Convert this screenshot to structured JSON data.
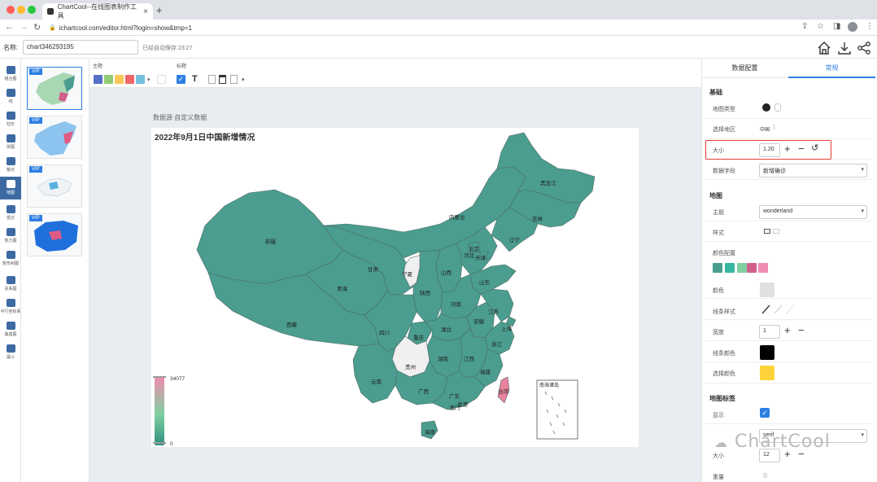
{
  "browser": {
    "tab_title": "ChartCool--在线图表制作工具",
    "url": "ichartcool.com/editor.html?login=show&tmp=1"
  },
  "appbar": {
    "name_label": "名称:",
    "name_value": "chart346293195",
    "save_status": "已经自动保存 23:27"
  },
  "left_nav": [
    {
      "label": "组合图",
      "icon": "combo-chart-icon"
    },
    {
      "label": "线",
      "icon": "line-chart-icon"
    },
    {
      "label": "柱形",
      "icon": "bar-chart-icon"
    },
    {
      "label": "饼图",
      "icon": "pie-chart-icon"
    },
    {
      "label": "散点",
      "icon": "scatter-chart-icon"
    },
    {
      "label": "地图",
      "icon": "map-chart-icon"
    },
    {
      "label": "雷达",
      "icon": "radar-chart-icon"
    },
    {
      "label": "热力图",
      "icon": "heatmap-icon"
    },
    {
      "label": "矩形树图",
      "icon": "treemap-icon"
    },
    {
      "label": "关系图",
      "icon": "graph-icon"
    },
    {
      "label": "平行坐标系",
      "icon": "parallel-icon"
    },
    {
      "label": "桑基图",
      "icon": "sankey-icon"
    },
    {
      "label": "漏斗",
      "icon": "funnel-icon"
    }
  ],
  "thumbs": [
    {
      "badge": "VIP"
    },
    {
      "badge": "VIP"
    },
    {
      "badge": "VIP"
    },
    {
      "badge": "VIP"
    }
  ],
  "toolbar": {
    "theme_label": "主题",
    "title_label": "标题",
    "theme_colors": [
      "#5470c6",
      "#91cc75",
      "#fac858",
      "#ee6666",
      "#73c0de"
    ]
  },
  "chart": {
    "data_source": "数据源 自定义数据",
    "title": "2022年9月1日中国新增情况",
    "legend_max": "34077",
    "legend_min": "0",
    "inset_label": "南海诸岛",
    "colors": {
      "base": "#4a9d8f",
      "empty": "#f0f0f0",
      "highlight": "#e8829f"
    },
    "provinces": [
      "新疆",
      "西藏",
      "青海",
      "甘肃",
      "内蒙古",
      "黑龙江",
      "吉林",
      "辽宁",
      "北京",
      "天津",
      "河北",
      "山西",
      "宁夏",
      "陕西",
      "山东",
      "河南",
      "四川",
      "重庆",
      "湖北",
      "安徽",
      "江苏",
      "上海",
      "浙江",
      "湖南",
      "江西",
      "福建",
      "贵州",
      "云南",
      "广西",
      "广东",
      "香港",
      "澳门",
      "海南",
      "台湾"
    ]
  },
  "right_panel": {
    "tabs": [
      "数据配置",
      "常规"
    ],
    "basic": {
      "title": "基础",
      "map_type_label": "地图类型",
      "region_label": "选择地区",
      "region_value": "中国",
      "size_label": "大小",
      "size_value": "1.20",
      "field_label": "数据字段",
      "field_value": "新增确诊"
    },
    "map": {
      "title": "地图",
      "theme_label": "主题",
      "theme_value": "wonderland",
      "style_label": "样式",
      "palette_label": "颜色配置",
      "palette": [
        "#4a9d8f",
        "#36b5a0",
        "#7fd0a0",
        "#d1608a",
        "#ef8cb0"
      ],
      "color_label": "颜色",
      "line_style_label": "线条样式",
      "width_label": "宽度",
      "width_value": "1",
      "line_color_label": "线条颜色",
      "select_color_label": "选择颜色"
    },
    "labels": {
      "title": "地图标签",
      "show_label": "显示",
      "font_value": "serif",
      "size_label": "大小",
      "size_value": "12",
      "bold_label": "重量"
    }
  },
  "watermark": "ChartCool"
}
